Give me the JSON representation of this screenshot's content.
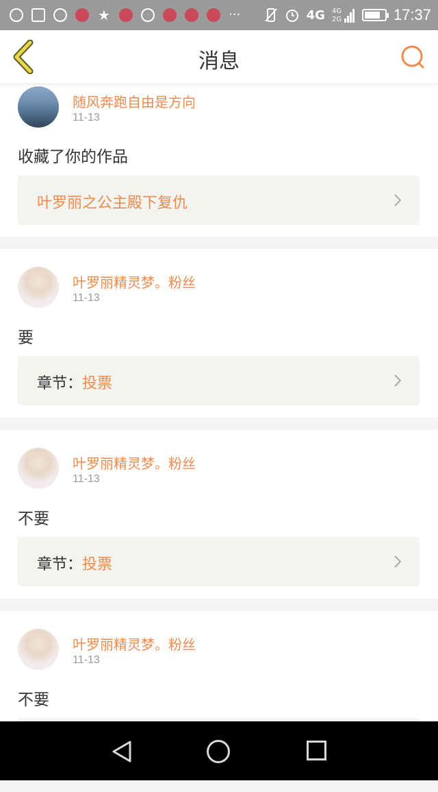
{
  "status_bar": {
    "icons": [
      "chat-bubble-icon",
      "image-icon",
      "block-icon",
      "app-icon",
      "star-icon",
      "app-icon",
      "sync-icon",
      "app-icon",
      "app-icon",
      "app-icon",
      "more-icon"
    ],
    "network": "4G",
    "network2": "4G 2G",
    "time": "17:37",
    "battery_level": 0.8
  },
  "header": {
    "title": "消息",
    "accent_color": "#f08a4b"
  },
  "messages": [
    {
      "user": "随风奔跑自由是方向",
      "date": "11-13",
      "text": "收藏了你的作品",
      "link_prefix": "",
      "link": "叶罗丽之公主殿下复仇"
    },
    {
      "user": "叶罗丽精灵梦。粉丝",
      "date": "11-13",
      "text": "要",
      "link_prefix": "章节：",
      "link": "投票"
    },
    {
      "user": "叶罗丽精灵梦。粉丝",
      "date": "11-13",
      "text": "不要",
      "link_prefix": "章节：",
      "link": "投票"
    },
    {
      "user": "叶罗丽精灵梦。粉丝",
      "date": "11-13",
      "text": "不要",
      "link_prefix": "",
      "link": ""
    }
  ]
}
